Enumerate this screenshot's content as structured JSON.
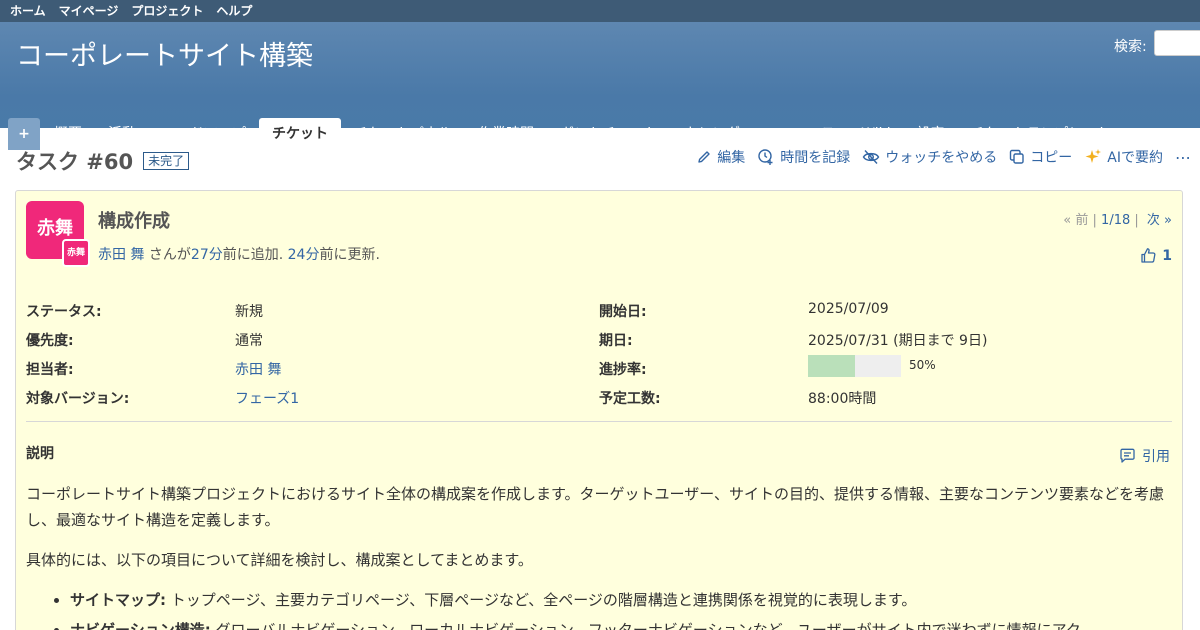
{
  "top_menu": [
    "ホーム",
    "マイページ",
    "プロジェクト",
    "ヘルプ"
  ],
  "header": {
    "project_title": "コーポレートサイト構築",
    "search_label": "検索:"
  },
  "tabs": [
    {
      "label": "+"
    },
    {
      "label": "概要"
    },
    {
      "label": "活動"
    },
    {
      "label": "ロードマップ"
    },
    {
      "label": "チケット"
    },
    {
      "label": "チケットパネル"
    },
    {
      "label": "作業時間"
    },
    {
      "label": "ガントチャート"
    },
    {
      "label": "カレンダー"
    },
    {
      "label": "ニュース"
    },
    {
      "label": "Wiki"
    },
    {
      "label": "設定"
    },
    {
      "label": "チケットテンプレート"
    }
  ],
  "issue": {
    "title": "タスク #60",
    "status_badge": "未完了",
    "subject": "構成作成",
    "avatar_text": "赤舞",
    "author_name": "赤田 舞",
    "author_suffix": " さんが",
    "added_ago": "27分",
    "added_text": "前に追加. ",
    "updated_ago": "24分",
    "updated_text": "前に更新.",
    "prev": "« 前",
    "position": "1/18",
    "next": "次 »",
    "likes": "1"
  },
  "actions": {
    "edit": "編集",
    "log_time": "時間を記録",
    "unwatch": "ウォッチをやめる",
    "copy": "コピー",
    "ai_summary": "AIで要約",
    "more": "⋯"
  },
  "attributes": {
    "status_label": "ステータス:",
    "status": "新規",
    "priority_label": "優先度:",
    "priority": "通常",
    "assignee_label": "担当者:",
    "assignee": "赤田 舞",
    "version_label": "対象バージョン:",
    "version": "フェーズ1",
    "start_label": "開始日:",
    "start": "2025/07/09",
    "due_label": "期日:",
    "due": "2025/07/31 (期日まで 9日)",
    "progress_label": "進捗率:",
    "progress": 50,
    "progress_text": "50%",
    "estimate_label": "予定工数:",
    "estimate": "88:00時間"
  },
  "description": {
    "label": "説明",
    "quote": "引用",
    "p1": "コーポレートサイト構築プロジェクトにおけるサイト全体の構成案を作成します。ターゲットユーザー、サイトの目的、提供する情報、主要なコンテンツ要素などを考慮し、最適なサイト構造を定義します。",
    "p2": "具体的には、以下の項目について詳細を検討し、構成案としてまとめます。",
    "items": [
      {
        "term": "サイトマップ:",
        "text": " トップページ、主要カテゴリページ、下層ページなど、全ページの階層構造と連携関係を視覚的に表現します。"
      },
      {
        "term": "ナビゲーション構造:",
        "text": " グローバルナビゲーション、ローカルナビゲーション、フッターナビゲーションなど、ユーザーがサイト内で迷わずに情報にアク"
      }
    ]
  }
}
